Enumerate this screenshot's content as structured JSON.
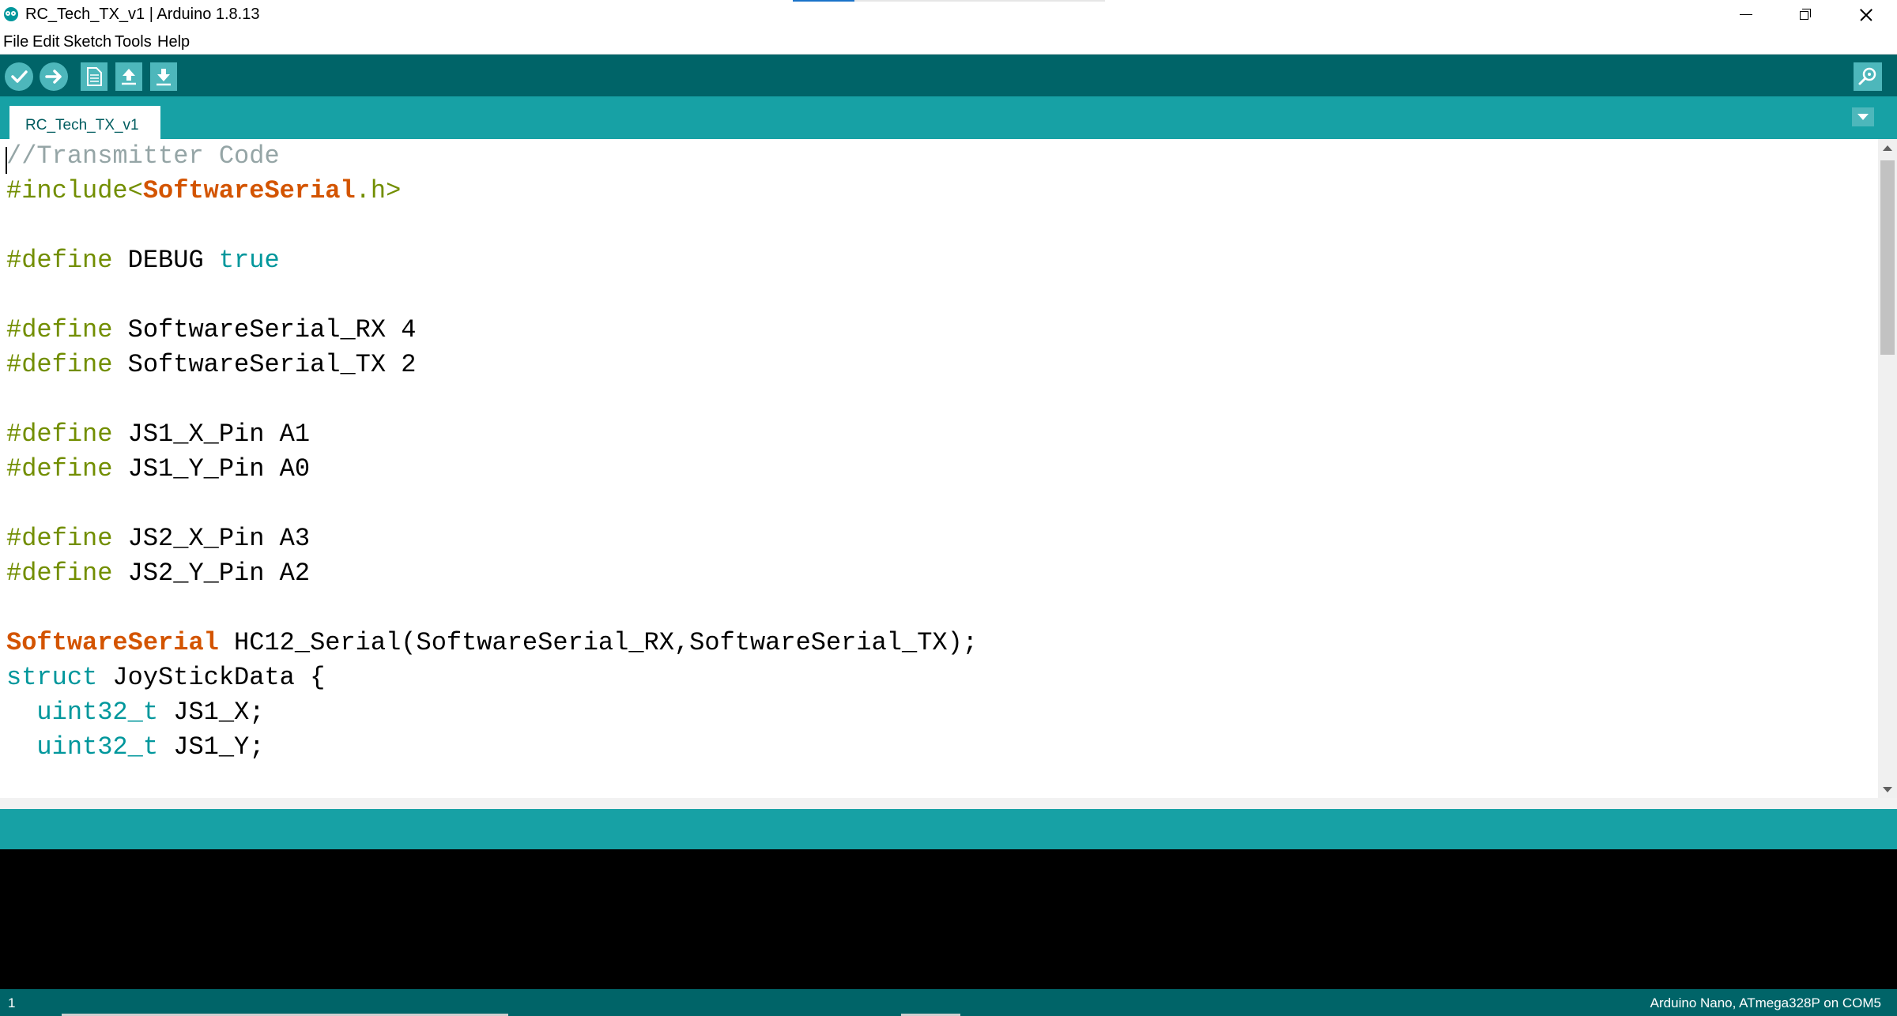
{
  "window": {
    "title": "RC_Tech_TX_v1 | Arduino 1.8.13",
    "icons": [
      "arduino-logo-icon",
      "minimize-icon",
      "restore-icon",
      "close-icon"
    ]
  },
  "menu": {
    "items": [
      "File",
      "Edit",
      "Sketch",
      "Tools",
      "Help"
    ]
  },
  "toolbar": {
    "buttons": [
      {
        "name": "verify",
        "icon": "checkmark-icon"
      },
      {
        "name": "upload",
        "icon": "arrow-right-icon"
      },
      {
        "name": "new",
        "icon": "new-file-icon"
      },
      {
        "name": "open",
        "icon": "arrow-up-icon"
      },
      {
        "name": "save",
        "icon": "arrow-down-icon"
      },
      {
        "name": "serial-monitor",
        "icon": "magnifier-icon"
      }
    ]
  },
  "tabs": {
    "active": "RC_Tech_TX_v1",
    "menu_icon": "tab-menu-triangle-icon"
  },
  "editor": {
    "lines": [
      {
        "segments": [
          {
            "text": "//Transmitter Code",
            "style": "comment"
          }
        ]
      },
      {
        "segments": [
          {
            "text": "#include<",
            "style": "pre"
          },
          {
            "text": "SoftwareSerial",
            "style": "class"
          },
          {
            "text": ".h>",
            "style": "pre"
          }
        ]
      },
      {
        "segments": []
      },
      {
        "segments": [
          {
            "text": "#define ",
            "style": "pre"
          },
          {
            "text": "DEBUG ",
            "style": "plain"
          },
          {
            "text": "true",
            "style": "lit"
          }
        ]
      },
      {
        "segments": []
      },
      {
        "segments": [
          {
            "text": "#define ",
            "style": "pre"
          },
          {
            "text": "SoftwareSerial_RX 4",
            "style": "plain"
          }
        ]
      },
      {
        "segments": [
          {
            "text": "#define ",
            "style": "pre"
          },
          {
            "text": "SoftwareSerial_TX 2",
            "style": "plain"
          }
        ]
      },
      {
        "segments": []
      },
      {
        "segments": [
          {
            "text": "#define ",
            "style": "pre"
          },
          {
            "text": "JS1_X_Pin A1",
            "style": "plain"
          }
        ]
      },
      {
        "segments": [
          {
            "text": "#define ",
            "style": "pre"
          },
          {
            "text": "JS1_Y_Pin A0",
            "style": "plain"
          }
        ]
      },
      {
        "segments": []
      },
      {
        "segments": [
          {
            "text": "#define ",
            "style": "pre"
          },
          {
            "text": "JS2_X_Pin A3",
            "style": "plain"
          }
        ]
      },
      {
        "segments": [
          {
            "text": "#define ",
            "style": "pre"
          },
          {
            "text": "JS2_Y_Pin A2",
            "style": "plain"
          }
        ]
      },
      {
        "segments": []
      },
      {
        "segments": [
          {
            "text": "SoftwareSerial",
            "style": "class"
          },
          {
            "text": " HC12_Serial(SoftwareSerial_RX,SoftwareSerial_TX);",
            "style": "plain"
          }
        ]
      },
      {
        "segments": [
          {
            "text": "struct",
            "style": "struct"
          },
          {
            "text": " JoyStickData {",
            "style": "plain"
          }
        ]
      },
      {
        "segments": [
          {
            "text": "  ",
            "style": "plain"
          },
          {
            "text": "uint32_t",
            "style": "type"
          },
          {
            "text": " JS1_X;",
            "style": "plain"
          }
        ]
      },
      {
        "segments": [
          {
            "text": "  ",
            "style": "plain"
          },
          {
            "text": "uint32_t",
            "style": "type"
          },
          {
            "text": " JS1_Y;",
            "style": "plain"
          }
        ]
      }
    ]
  },
  "status": {
    "line_number": "1",
    "board": "Arduino Nano, ATmega328P on COM5"
  },
  "colors": {
    "toolbar": "#006468",
    "tabbar": "#17a1a5",
    "preprocessor": "#728e00",
    "class": "#d35400",
    "literal": "#00979c",
    "comment": "#95a5a6"
  }
}
